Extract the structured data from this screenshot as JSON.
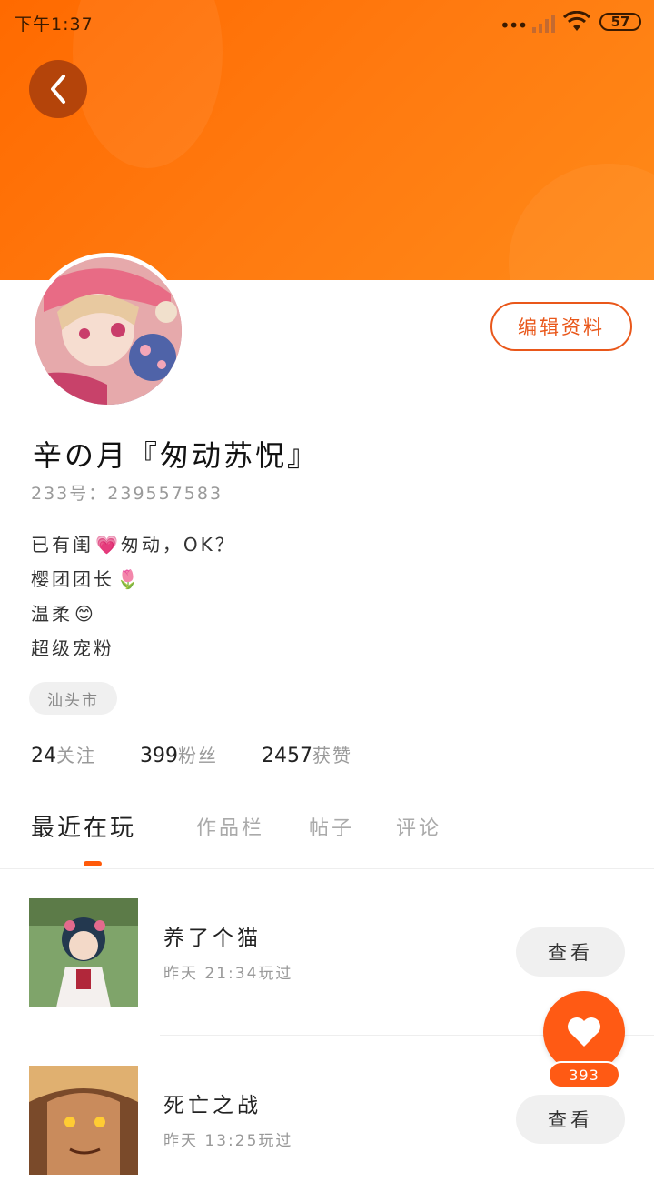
{
  "status_bar": {
    "time": "下午1:37",
    "battery": "57",
    "dots": "•••"
  },
  "profile": {
    "edit_label": "编辑资料",
    "name": "辛の月『匆动苏怳』",
    "uid": "233号：239557583",
    "bio": [
      {
        "text": "已有闺",
        "emoji": "💗",
        "after": "匆动，OK？"
      },
      {
        "text": "樱团团长",
        "emoji": "🌷",
        "after": ""
      },
      {
        "text": "温柔",
        "emoji": "😊",
        "after": ""
      },
      {
        "text": "超级宠粉",
        "emoji": "",
        "after": ""
      }
    ],
    "location": "汕头市",
    "stats": [
      {
        "num": "24",
        "label": "关注"
      },
      {
        "num": "399",
        "label": "粉丝"
      },
      {
        "num": "2457",
        "label": "获赞"
      }
    ]
  },
  "tabs": [
    "最近在玩",
    "作品栏",
    "帖子",
    "评论"
  ],
  "games": [
    {
      "title": "养了个猫",
      "sub": "昨天 21:34玩过",
      "button": "查看"
    },
    {
      "title": "死亡之战",
      "sub": "昨天 13:25玩过",
      "button": "查看"
    }
  ],
  "like": {
    "count": "393"
  },
  "colors": {
    "accent": "#ff5a0a",
    "banner": "#ff7a10"
  }
}
